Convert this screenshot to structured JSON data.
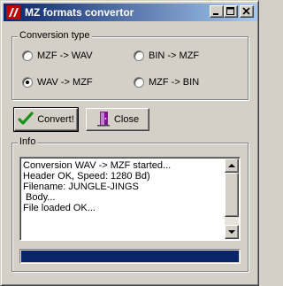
{
  "window": {
    "title": "MZ formats convertor",
    "title_icon": "red-pen-app-icon"
  },
  "conversion": {
    "group_label": "Conversion type",
    "options": [
      {
        "label": "MZF -> WAV",
        "checked": false
      },
      {
        "label": "BIN -> MZF",
        "checked": false
      },
      {
        "label": "WAV -> MZF",
        "checked": true
      },
      {
        "label": "MZF -> BIN",
        "checked": false
      }
    ]
  },
  "buttons": {
    "convert_label": "Convert!",
    "close_label": "Close"
  },
  "info": {
    "group_label": "Info",
    "log_lines": [
      "Conversion WAV -> MZF started...",
      "Header OK, Speed: 1280 Bd)",
      "Filename: JUNGLE-JINGS",
      " Body...",
      "File loaded OK..."
    ],
    "progress_fraction": 1.0,
    "progress_color": "#0a246a"
  },
  "colors": {
    "titlebar_start": "#0a246a",
    "titlebar_end": "#a6caf0",
    "face": "#d4d0c8",
    "check_green": "#1a8f1a"
  }
}
